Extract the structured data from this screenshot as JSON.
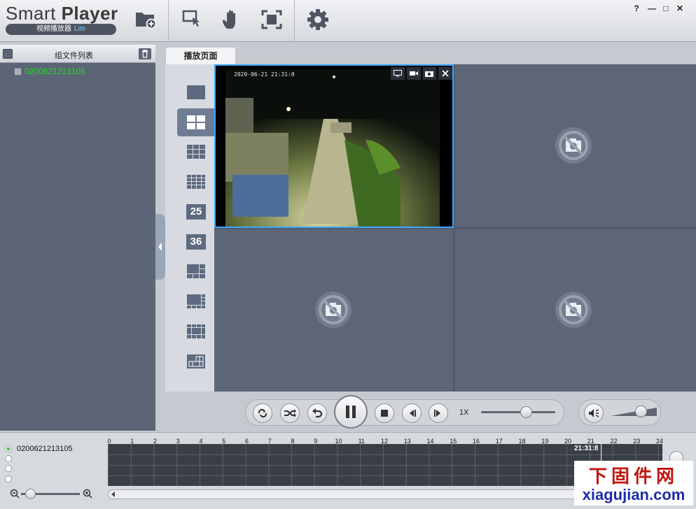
{
  "app": {
    "title_light": "Smart ",
    "title_bold": "Player",
    "subtitle": "视频播放器",
    "subtitle_tag": "Lite"
  },
  "toolbar": {
    "items": [
      {
        "name": "open-folder",
        "icon": "folder-add-icon"
      },
      {
        "name": "select",
        "icon": "pointer-select-icon"
      },
      {
        "name": "pan",
        "icon": "hand-icon"
      },
      {
        "name": "fullscreen",
        "icon": "fullscreen-icon"
      },
      {
        "name": "settings",
        "icon": "gear-icon"
      }
    ]
  },
  "window_controls": {
    "help": "?",
    "minimize": "—",
    "maximize": "□",
    "close": "✕"
  },
  "sidebar": {
    "header": "组文件列表",
    "files": [
      {
        "label": "0200621213105"
      }
    ]
  },
  "tabs": {
    "active": "播放页面"
  },
  "layouts": [
    {
      "name": "1-split",
      "label": ""
    },
    {
      "name": "4-split",
      "label": "",
      "selected": true
    },
    {
      "name": "9-split",
      "label": ""
    },
    {
      "name": "16-split",
      "label": ""
    },
    {
      "name": "25-split",
      "label": "25"
    },
    {
      "name": "36-split",
      "label": "36"
    },
    {
      "name": "6-split",
      "label": ""
    },
    {
      "name": "8-split",
      "label": ""
    },
    {
      "name": "12-split",
      "label": ""
    },
    {
      "name": "custom-split",
      "label": ""
    }
  ],
  "video": {
    "timestamp": "2020-06-21 21:31:0"
  },
  "playback": {
    "speed": "1X",
    "progress": 0.6,
    "volume": 0.65
  },
  "timeline": {
    "channel": "0200621213105",
    "hours": [
      "0",
      "1",
      "2",
      "3",
      "4",
      "5",
      "6",
      "7",
      "8",
      "9",
      "10",
      "11",
      "12",
      "13",
      "14",
      "15",
      "16",
      "17",
      "18",
      "19",
      "20",
      "21",
      "22",
      "23",
      "24"
    ],
    "current_time": "21:31:8",
    "zoom": 0.15
  },
  "watermark": {
    "line1": "下固件网",
    "line2": "xiagujian.com"
  },
  "colors": {
    "accent": "#39a7ff",
    "file_green": "#26d926",
    "watermark_red": "#c0140f",
    "watermark_blue": "#1d2ea8"
  }
}
